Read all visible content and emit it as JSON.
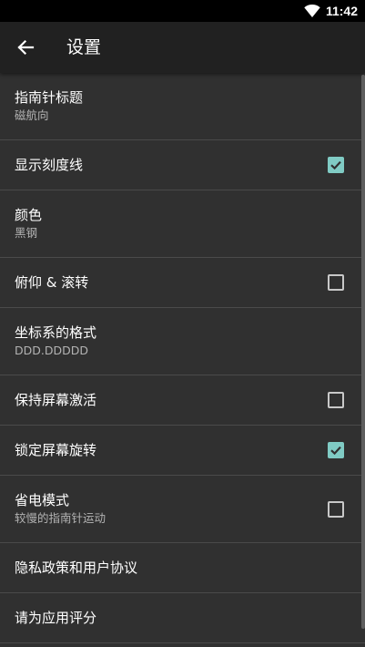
{
  "status_bar": {
    "time": "11:42",
    "icons": [
      "wifi-icon"
    ]
  },
  "toolbar": {
    "back_icon": "arrow-back-icon",
    "title": "设置"
  },
  "colors": {
    "background": "#303030",
    "toolbar": "#212121",
    "accent": "#80cbc4",
    "divider": "#4a4a4a"
  },
  "settings": [
    {
      "title": "指南针标题",
      "summary": "磁航向"
    },
    {
      "title": "显示刻度线",
      "checked": true
    },
    {
      "title": "颜色",
      "summary": "黑钢"
    },
    {
      "title": "俯仰 & 滚转",
      "checked": false
    },
    {
      "title": "坐标系的格式",
      "summary": "DDD.DDDDD"
    },
    {
      "title": "保持屏幕激活",
      "checked": false
    },
    {
      "title": "锁定屏幕旋转",
      "checked": true
    },
    {
      "title": "省电模式",
      "summary": "较慢的指南针运动",
      "checked": false
    },
    {
      "title": "隐私政策和用户协议"
    },
    {
      "title": "请为应用评分"
    }
  ]
}
